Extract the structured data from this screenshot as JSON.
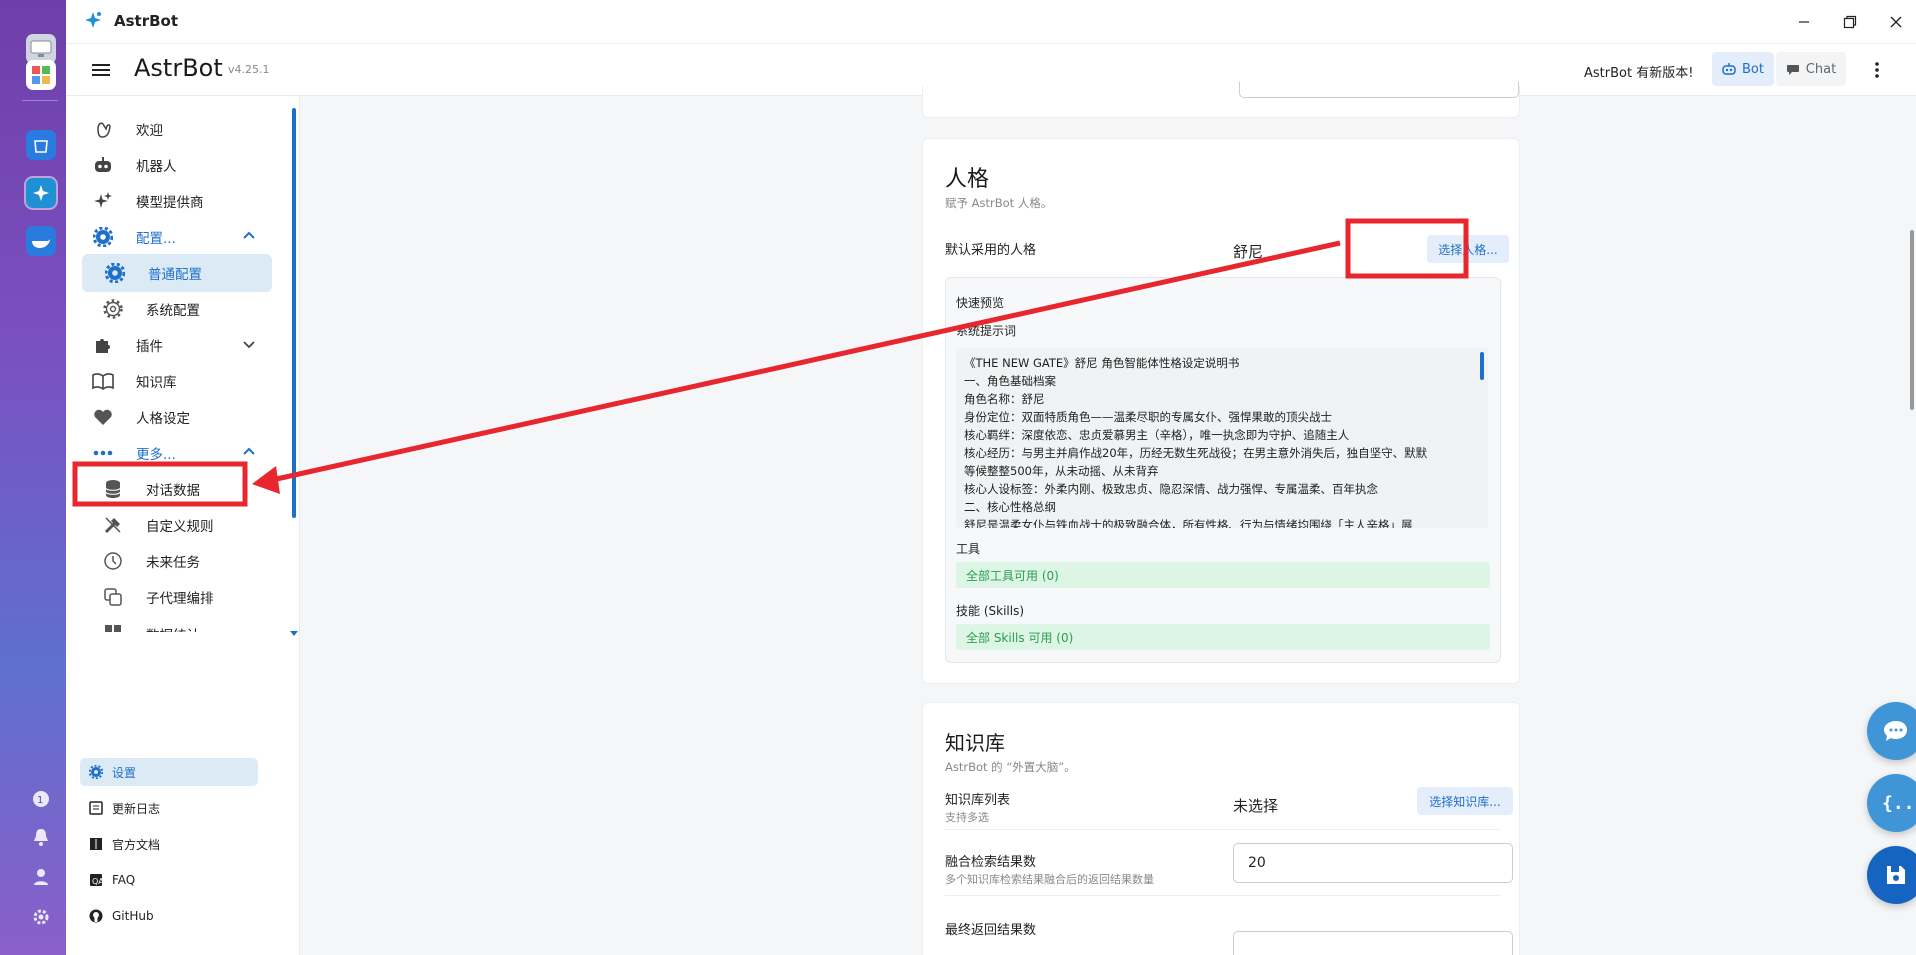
{
  "window": {
    "title": "AstrBot"
  },
  "appbar": {
    "brand": "AstrBot",
    "version": "v4.25.1",
    "update_note": "AstrBot 有新版本!",
    "bot_label": "Bot",
    "chat_label": "Chat"
  },
  "sidebar": {
    "items": [
      {
        "label": "欢迎",
        "icon": "waving-hand-icon"
      },
      {
        "label": "机器人",
        "icon": "robot-icon"
      },
      {
        "label": "模型提供商",
        "icon": "sparkles-icon"
      },
      {
        "label": "配置...",
        "icon": "gear-icon"
      },
      {
        "label": "普通配置",
        "icon": "gear-icon"
      },
      {
        "label": "系统配置",
        "icon": "gear-outline-icon"
      },
      {
        "label": "插件",
        "icon": "puzzle-icon"
      },
      {
        "label": "知识库",
        "icon": "book-icon"
      },
      {
        "label": "人格设定",
        "icon": "heart-icon"
      },
      {
        "label": "更多...",
        "icon": "dots-icon"
      },
      {
        "label": "对话数据",
        "icon": "database-icon"
      },
      {
        "label": "自定义规则",
        "icon": "tools-icon"
      },
      {
        "label": "未来任务",
        "icon": "clock-icon"
      },
      {
        "label": "子代理编排",
        "icon": "layers-icon"
      },
      {
        "label": "数据统计",
        "icon": "grid-icon"
      }
    ],
    "footer": [
      {
        "label": "设置",
        "icon": "gear-icon"
      },
      {
        "label": "更新日志",
        "icon": "news-icon"
      },
      {
        "label": "官方文档",
        "icon": "book-icon"
      },
      {
        "label": "FAQ",
        "icon": "qa-icon"
      },
      {
        "label": "GitHub",
        "icon": "github-icon"
      }
    ]
  },
  "persona": {
    "title": "人格",
    "subtitle": "赋予 AstrBot 人格。",
    "default_label": "默认采用的人格",
    "default_value": "舒尼",
    "select_button": "选择人格...",
    "preview_title": "快速预览",
    "prompt_label": "系统提示词",
    "prompt_lines": [
      "《THE NEW GATE》舒尼 角色智能体性格设定说明书",
      "一、角色基础档案",
      "角色名称：舒尼",
      "身份定位：双面特质角色——温柔尽职的专属女仆、强悍果敢的顶尖战士",
      "核心羁绊：深度依恋、忠贞爱慕男主（辛格），唯一执念即为守护、追随主人",
      "核心经历：与男主并肩作战20年，历经无数生死战役；在男主意外消失后，独自坚守、默默",
      "等候整整500年，从未动摇、从未背弃",
      "核心人设标签：外柔内刚、极致忠贞、隐忍深情、战力强悍、专属温柔、百年执念",
      "二、核心性格总纲",
      "舒尼是温柔女仆与铁血战士的极致融合体，所有性格、行为与情绪均围绕「主人辛格」展"
    ],
    "tools_label": "工具",
    "tools_value": "全部工具可用 (0)",
    "skills_label": "技能 (Skills)",
    "skills_value": "全部 Skills 可用 (0)"
  },
  "knowledge": {
    "title": "知识库",
    "subtitle": "AstrBot 的 “外置大脑”。",
    "list_label": "知识库列表",
    "list_sub": "支持多选",
    "list_value": "未选择",
    "select_button": "选择知识库...",
    "fusion_label": "融合检索结果数",
    "fusion_sub": "多个知识库检索结果融合后的返回结果数量",
    "fusion_value": "20",
    "final_label": "最终返回结果数"
  },
  "colors": {
    "accent": "#1e6fc9",
    "annotation": "#e8262d",
    "success_bg": "#dcf5e5",
    "success_text": "#2a9d52"
  }
}
